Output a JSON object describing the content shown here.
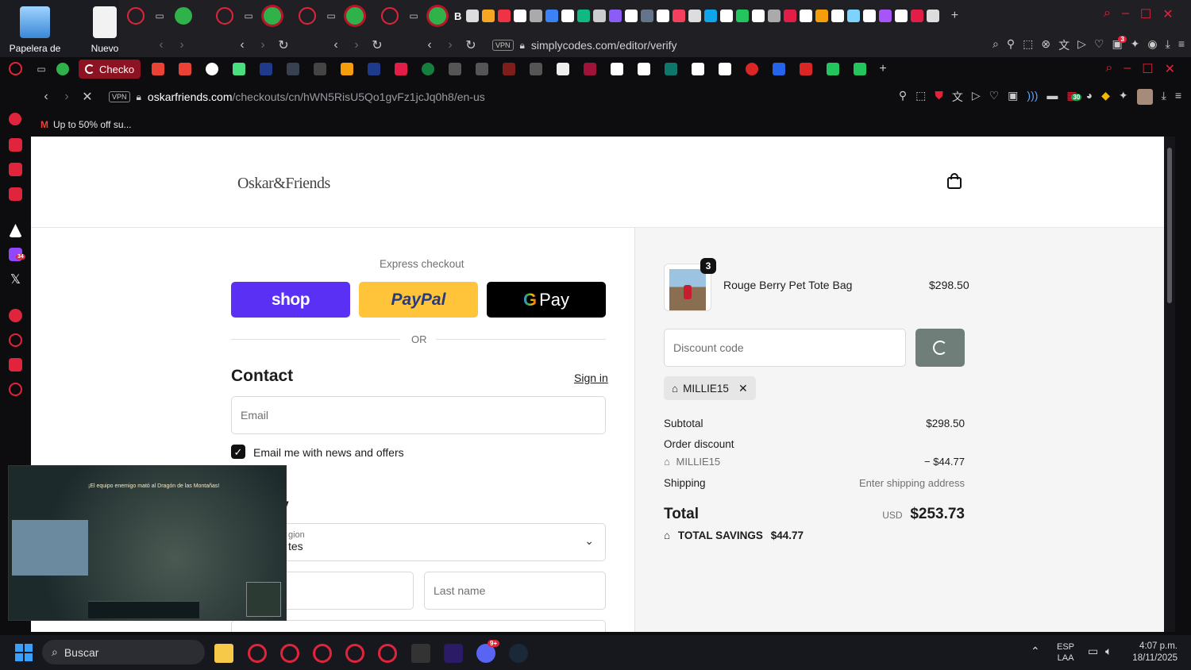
{
  "desktop": {
    "icons": [
      {
        "label": "Papelera de"
      },
      {
        "label": "Nuevo"
      }
    ]
  },
  "back_browser": {
    "address": "simplycodes.com/editor/verify",
    "vpn": "VPN",
    "tab_label": "B"
  },
  "front_browser": {
    "active_tab": "Checko",
    "address_host": "oskarfriends.com",
    "address_path": "/checkouts/cn/hWN5RisU5Qo1gvFz1jcJq0h8/en-us",
    "vpn": "VPN",
    "bookmark": "Up to 50% off su...",
    "extension_badge": "30",
    "sidebar_badge": "34",
    "back_badge": "3"
  },
  "store": {
    "logo": "Oskar&Friends"
  },
  "checkout": {
    "express_label": "Express checkout",
    "shop_label": "shop",
    "paypal_label": "PayPal",
    "gpay_label": "Pay",
    "or_label": "OR",
    "contact_title": "Contact",
    "sign_in": "Sign in",
    "email_placeholder": "Email",
    "newsletter_label": "Email me with news and offers",
    "newsletter_checked": true,
    "delivery_title_partial": "y",
    "region_label_partial": "gion",
    "region_value_partial": "tes",
    "last_name_placeholder": "Last name"
  },
  "summary": {
    "item_qty": "3",
    "item_name": "Rouge Berry Pet Tote Bag",
    "item_price": "$298.50",
    "discount_placeholder": "Discount code",
    "applied_code": "MILLIE15",
    "subtotal_label": "Subtotal",
    "subtotal_value": "$298.50",
    "order_discount_label": "Order discount",
    "discount_code": "MILLIE15",
    "discount_value": "− $44.77",
    "shipping_label": "Shipping",
    "shipping_value": "Enter shipping address",
    "total_label": "Total",
    "currency": "USD",
    "total_value": "$253.73",
    "savings_label": "TOTAL SAVINGS",
    "savings_value": "$44.77"
  },
  "pip": {
    "overlay_text": "¡El equipo enemigo mató al Dragón de las Montañas!"
  },
  "taskbar": {
    "search_placeholder": "Buscar",
    "lang_1": "ESP",
    "lang_2": "LAA",
    "time": "4:07 p.m.",
    "date": "18/11/2025",
    "discord_badge": "9+"
  },
  "colors": {
    "shop": "#5a31f4",
    "paypal": "#ffc439",
    "gpay": "#000000",
    "apply_btn": "#707e79",
    "opera_red": "#e0243b"
  }
}
